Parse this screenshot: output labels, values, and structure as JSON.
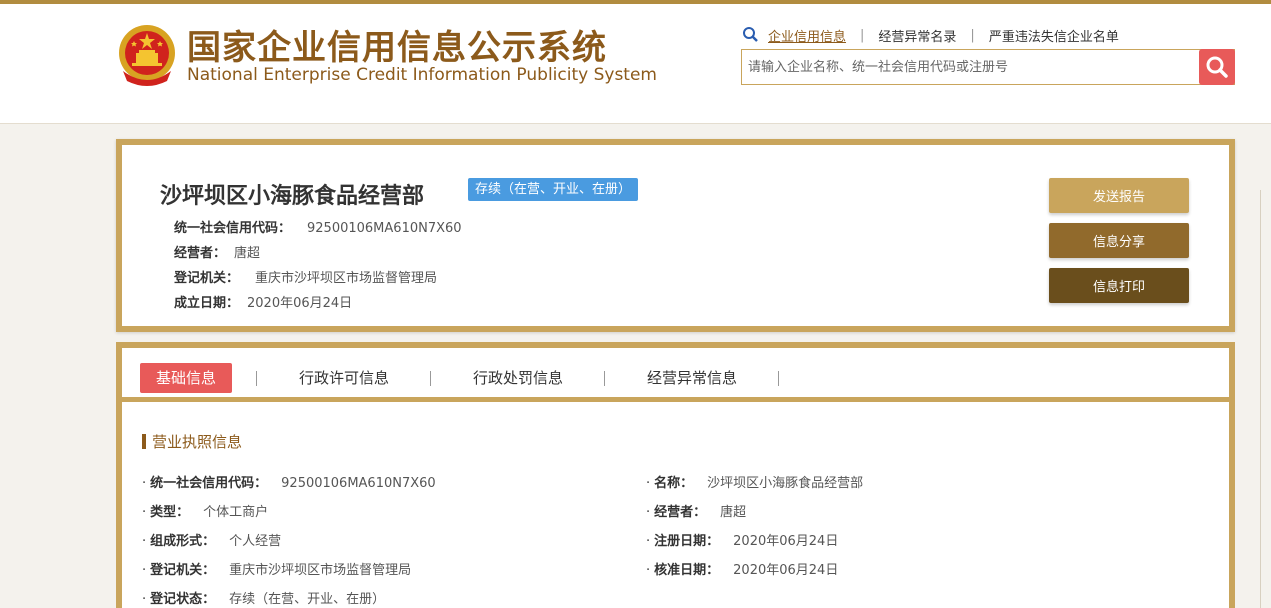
{
  "header": {
    "title_cn": "国家企业信用信息公示系统",
    "title_en": "National Enterprise Credit Information Publicity System",
    "links": [
      "企业信用信息",
      "经营异常名录",
      "严重违法失信企业名单"
    ],
    "search_placeholder": "请输入企业名称、统一社会信用代码或注册号"
  },
  "company": {
    "name": "沙坪坝区小海豚食品经营部",
    "status": "存续（在营、开业、在册）",
    "summary": [
      {
        "label": "统一社会信用代码：",
        "value": "92500106MA610N7X60"
      },
      {
        "label": "经营者：",
        "value": "唐超"
      },
      {
        "label": "登记机关：",
        "value": "重庆市沙坪坝区市场监督管理局"
      },
      {
        "label": "成立日期：",
        "value": "2020年06月24日"
      }
    ],
    "buttons": {
      "report": "发送报告",
      "share": "信息分享",
      "print": "信息打印"
    }
  },
  "tabs": [
    "基础信息",
    "行政许可信息",
    "行政处罚信息",
    "经营异常信息"
  ],
  "section": {
    "title": "营业执照信息",
    "left": [
      {
        "label": "统一社会信用代码：",
        "value": "92500106MA610N7X60"
      },
      {
        "label": "类型：",
        "value": "个体工商户"
      },
      {
        "label": "组成形式：",
        "value": "个人经营"
      },
      {
        "label": "登记机关：",
        "value": "重庆市沙坪坝区市场监督管理局"
      },
      {
        "label": "登记状态：",
        "value": "存续（在营、开业、在册）"
      }
    ],
    "right": [
      {
        "label": "名称：",
        "value": "沙坪坝区小海豚食品经营部"
      },
      {
        "label": "经营者：",
        "value": "唐超"
      },
      {
        "label": "注册日期：",
        "value": "2020年06月24日"
      },
      {
        "label": "核准日期：",
        "value": "2020年06月24日"
      }
    ]
  },
  "colors": {
    "gold": "#c9a55c",
    "brown": "#8c5a1b",
    "red": "#e85a59",
    "blue": "#4a9be0"
  }
}
